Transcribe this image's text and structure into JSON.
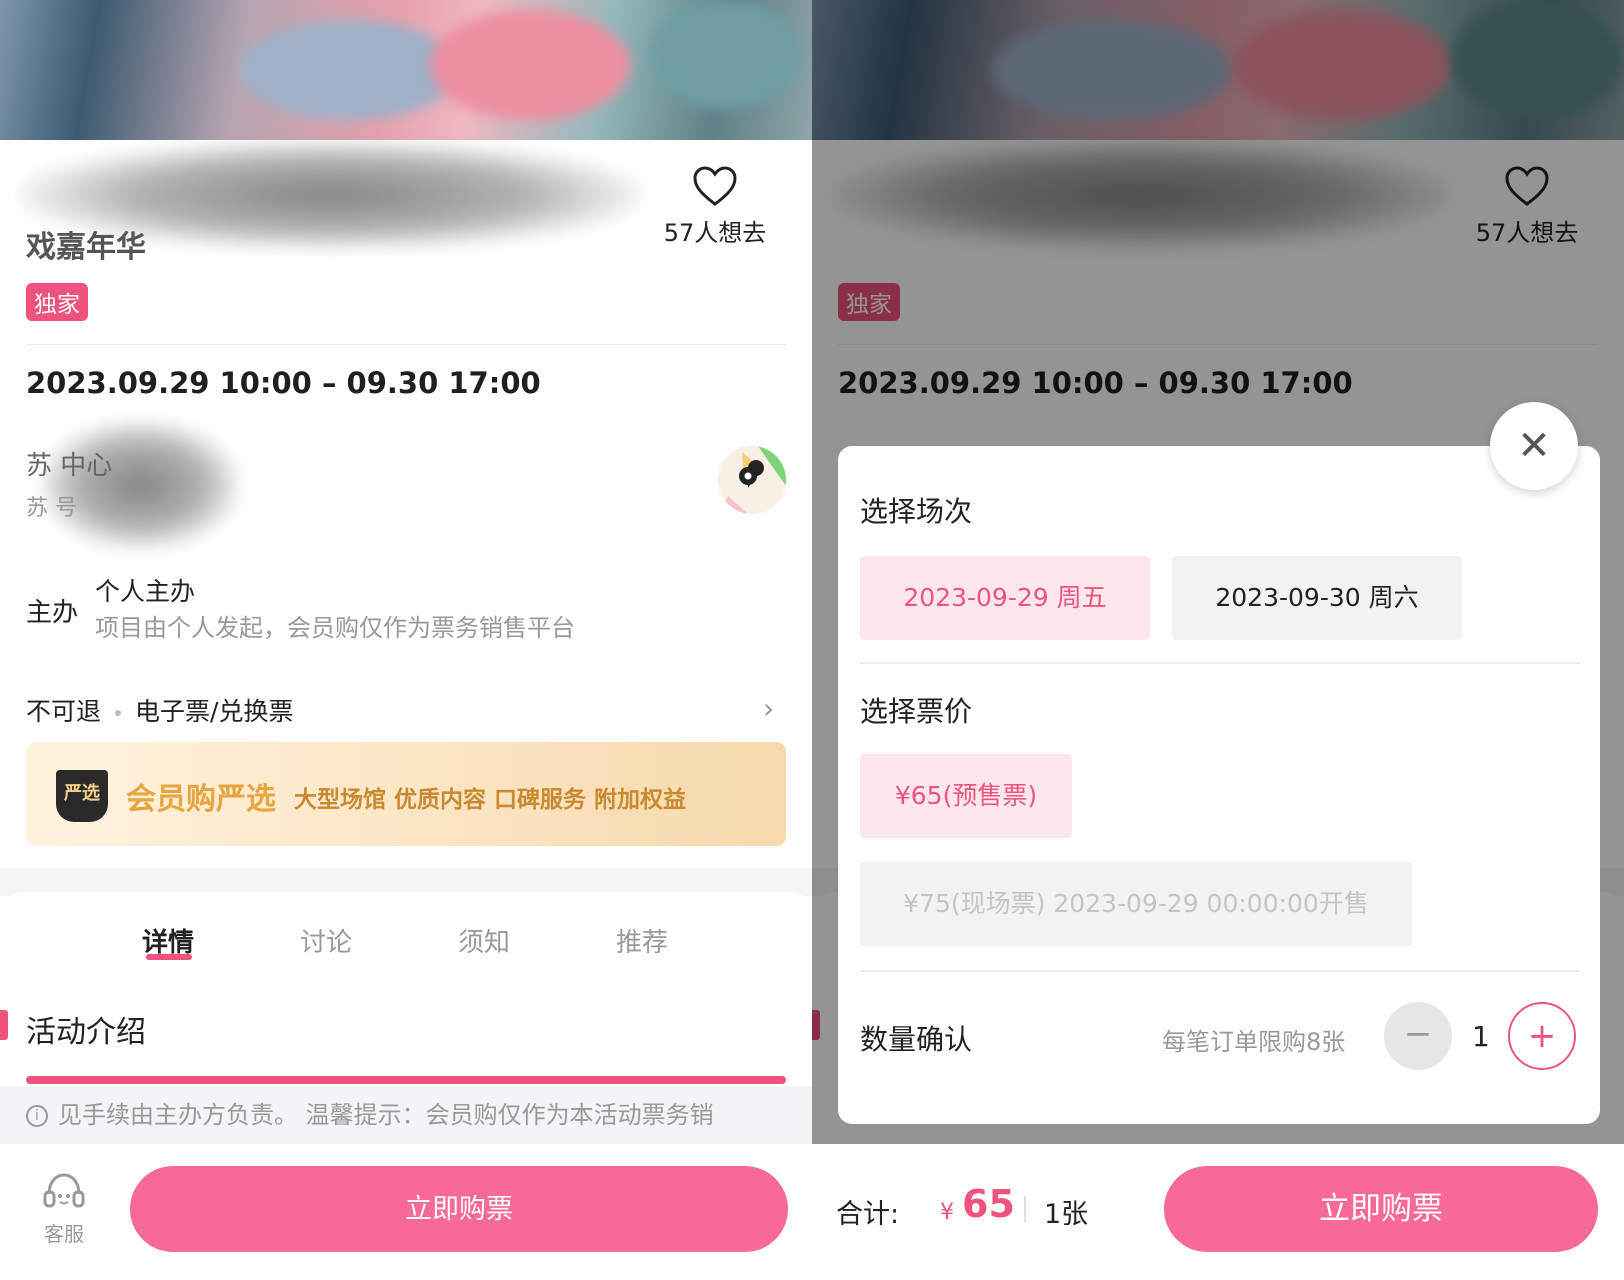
{
  "colors": {
    "accent": "#f0527f",
    "button": "#f66a95",
    "selected_bg": "#fde6ec"
  },
  "left": {
    "title": "戏嘉年华",
    "favorite": {
      "count_label": "57人想去",
      "icon": "heart-icon"
    },
    "tag": "独家",
    "datetime": "2023.09.29 10:00 – 09.30 17:00",
    "venue": {
      "name": "苏    中心",
      "address": "苏        号",
      "icon": "map-pin-icon"
    },
    "organizer": {
      "label": "主办",
      "name": "个人主办",
      "desc": "项目由个人发起，会员购仅作为票务销售平台"
    },
    "policy": {
      "refund": "不可退",
      "ticket_type": "电子票/兑换票"
    },
    "yanxuan": {
      "badge": "严选",
      "title": "会员购严选",
      "tags": "大型场馆  优质内容  口碑服务  附加权益"
    },
    "tabs": [
      "详情",
      "讨论",
      "须知",
      "推荐"
    ],
    "active_tab": "详情",
    "section_title": "活动介绍",
    "notice": "见手续由主办方负责。  温馨提示：会员购仅作为本活动票务销",
    "service_label": "客服",
    "buy_label": "立即购票"
  },
  "right": {
    "favorite": {
      "count_label": "57人想去"
    },
    "tag": "独家",
    "datetime": "2023.09.29 10:00 – 09.30 17:00",
    "sheet": {
      "session_heading": "选择场次",
      "sessions": [
        {
          "label": "2023-09-29 周五",
          "selected": true
        },
        {
          "label": "2023-09-30 周六",
          "selected": false
        }
      ],
      "price_heading": "选择票价",
      "prices": [
        {
          "label": "¥65(预售票)",
          "state": "selected"
        },
        {
          "label": "¥75(现场票) 2023-09-29 00:00:00开售",
          "state": "disabled"
        }
      ],
      "qty_heading": "数量确认",
      "limit": "每笔订单限购8张",
      "quantity": "1",
      "minus": "−",
      "plus": "+",
      "close": "✕"
    },
    "total": {
      "label": "合计:",
      "currency": "¥",
      "amount": "65",
      "count": "1张"
    },
    "buy_label": "立即购票"
  }
}
